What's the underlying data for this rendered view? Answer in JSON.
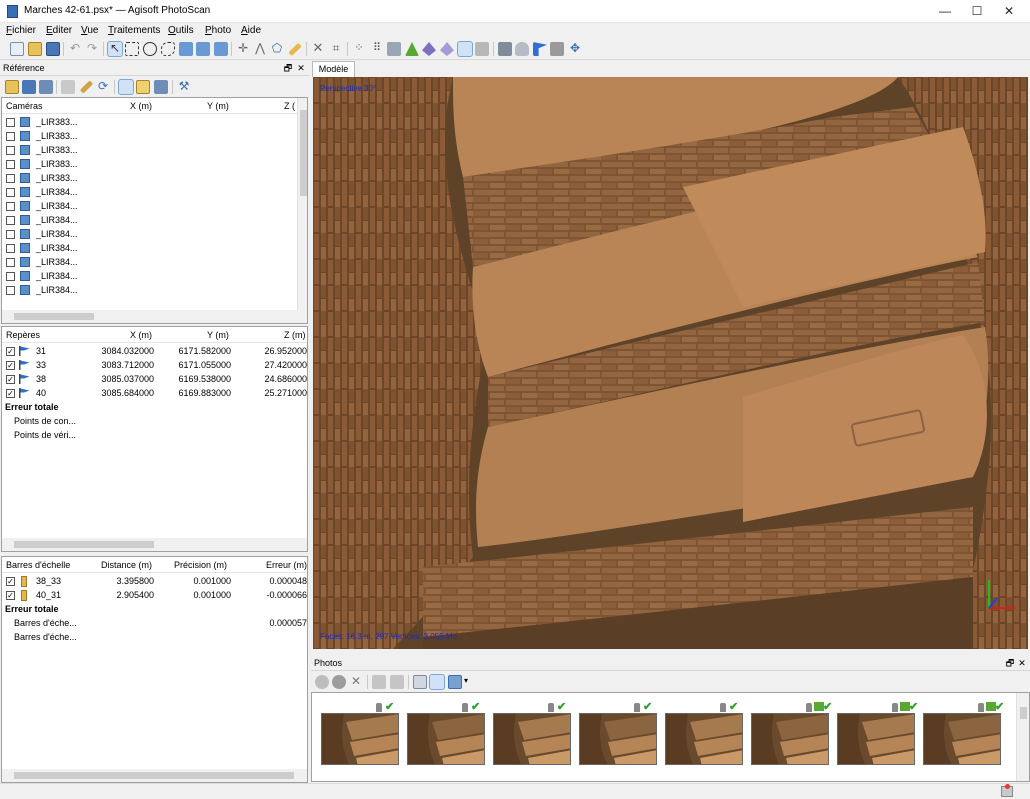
{
  "window": {
    "title": "Marches 42-61.psx* — Agisoft PhotoScan",
    "minimize_glyph": "—",
    "maximize_glyph": "☐",
    "close_glyph": "✕"
  },
  "menu": [
    {
      "key": "F",
      "rest": "ichier"
    },
    {
      "key": "E",
      "rest": "diter"
    },
    {
      "key": "V",
      "rest": "ue"
    },
    {
      "key": "T",
      "rest": "raitements"
    },
    {
      "key": "O",
      "rest": "utils"
    },
    {
      "key": "P",
      "rest": "hoto"
    },
    {
      "key": "A",
      "rest": "ide"
    }
  ],
  "reference": {
    "title": "Référence",
    "float_glyph": "🗗",
    "close_glyph": "✕",
    "cameras": {
      "headers": {
        "name": "Caméras",
        "x": "X (m)",
        "y": "Y (m)",
        "z": "Z ("
      },
      "rows": [
        "_LIR383...",
        "_LIR383...",
        "_LIR383...",
        "_LIR383...",
        "_LIR383...",
        "_LIR384...",
        "_LIR384...",
        "_LIR384...",
        "_LIR384...",
        "_LIR384...",
        "_LIR384...",
        "_LIR384...",
        "_LIR384..."
      ]
    },
    "markers": {
      "headers": {
        "name": "Repères",
        "x": "X (m)",
        "y": "Y (m)",
        "z": "Z (m)"
      },
      "rows": [
        {
          "label": "31",
          "x": "3084.032000",
          "y": "6171.582000",
          "z": "26.952000"
        },
        {
          "label": "33",
          "x": "3083.712000",
          "y": "6171.055000",
          "z": "27.420000"
        },
        {
          "label": "38",
          "x": "3085.037000",
          "y": "6169.538000",
          "z": "24.686000"
        },
        {
          "label": "40",
          "x": "3085.684000",
          "y": "6169.883000",
          "z": "25.271000"
        }
      ],
      "total": "Erreur totale",
      "control": "Points de con...",
      "check": "Points de véri..."
    },
    "scalebars": {
      "headers": {
        "name": "Barres d'échelle",
        "distance": "Distance (m)",
        "precision": "Précision (m)",
        "error": "Erreur (m)"
      },
      "rows": [
        {
          "label": "38_33",
          "distance": "3.395800",
          "precision": "0.001000",
          "error": "0.000048"
        },
        {
          "label": "40_31",
          "distance": "2.905400",
          "precision": "0.001000",
          "error": "-0.000066"
        }
      ],
      "total": "Erreur totale",
      "control": "Barres d'éche...",
      "control_error": "0.000057",
      "check": "Barres d'éche..."
    }
  },
  "model": {
    "tab": "Modèle",
    "perspective": "Perspective 30°",
    "info": "Faces: 16.3 m, 297 Vertices: 3,055 Mo"
  },
  "photos": {
    "title": "Photos",
    "float_glyph": "🗗",
    "close_glyph": "✕",
    "count": 8,
    "flagged": [
      false,
      false,
      false,
      false,
      false,
      true,
      true,
      true
    ]
  },
  "colors": {
    "accent": "#3b6fb3",
    "check": "#2aa32a",
    "brick": "#8a5a34",
    "stone": "#b07a4c"
  }
}
